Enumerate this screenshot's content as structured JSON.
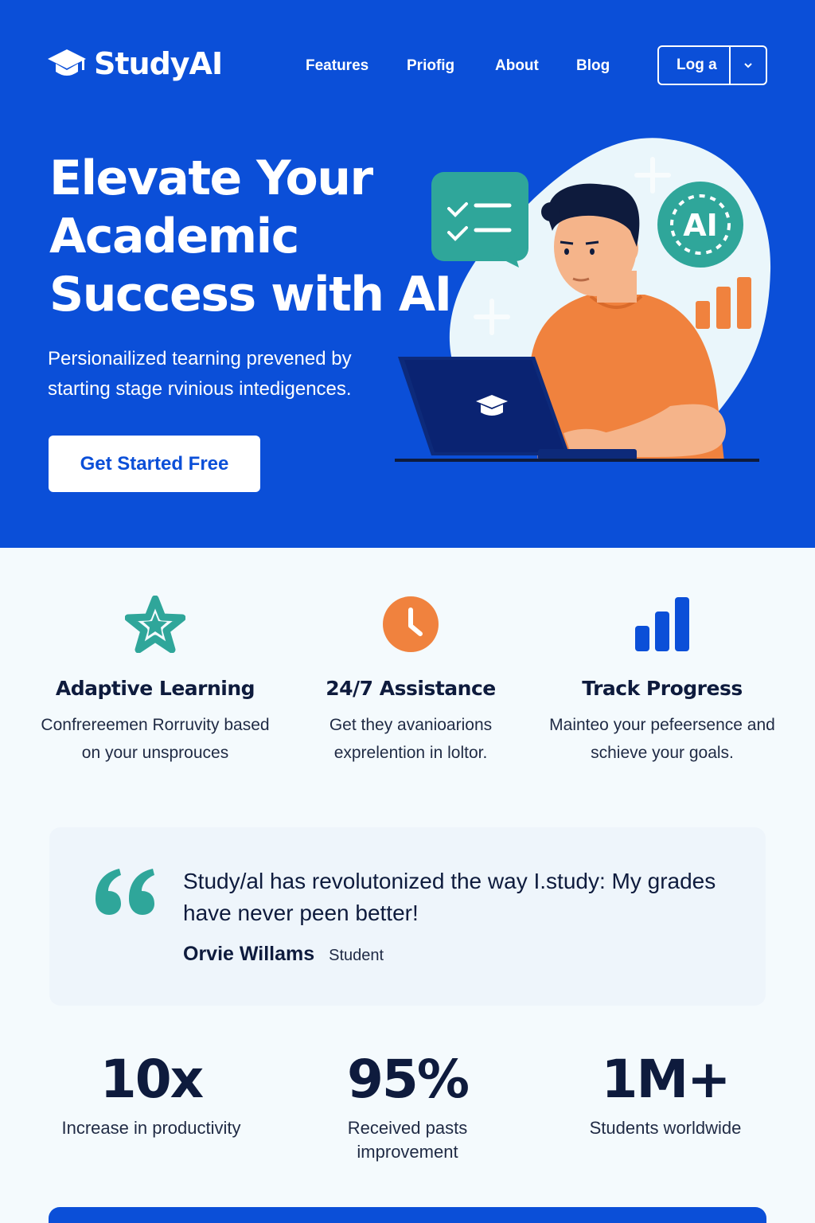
{
  "brand": {
    "name": "StudyAI"
  },
  "nav": {
    "items": [
      "Features",
      "Priofig",
      "About",
      "Blog"
    ],
    "login_label": "Log a"
  },
  "hero": {
    "title_lines": [
      "Elevate Your",
      "Academic",
      "Success with AI"
    ],
    "subtitle": "Persionailized tearning prevened by starting stage rvinious intedigences.",
    "cta_label": "Get Started Free",
    "illustration_badge": "AI"
  },
  "features": [
    {
      "icon": "star-icon",
      "title": "Adaptive Learning",
      "description": "Confrereemen Rorruvity based on your unsprouces"
    },
    {
      "icon": "clock-icon",
      "title": "24/7 Assistance",
      "description": "Get they avanioarions exprelention in loltor."
    },
    {
      "icon": "bar-chart-icon",
      "title": "Track Progress",
      "description": "Mainteo your pefeersence and schieve your goals."
    }
  ],
  "testimonial": {
    "quote": "Study/al has revolutonized the way I.study: My grades have never peen better!",
    "author": "Orvie Willams",
    "role": "Student"
  },
  "stats": [
    {
      "value": "10x",
      "label": "Increase in productivity"
    },
    {
      "value": "95%",
      "label": "Received pasts improvement"
    },
    {
      "value": "1M+",
      "label": "Students worldwide"
    }
  ],
  "colors": {
    "primary": "#0b4fd8",
    "teal": "#2fa69a",
    "orange": "#f0823e",
    "dark_text": "#0e1b3d"
  }
}
